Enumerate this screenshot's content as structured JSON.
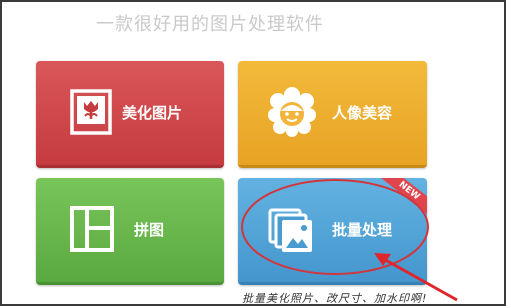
{
  "header": {
    "title": "一款很好用的图片处理软件"
  },
  "tiles": [
    {
      "label": "美化图片",
      "icon": "photo-flower-icon",
      "color": "#d0474b"
    },
    {
      "label": "人像美容",
      "icon": "face-icon",
      "color": "#eeb02f"
    },
    {
      "label": "拼图",
      "icon": "collage-icon",
      "color": "#6ab74d"
    },
    {
      "label": "批量处理",
      "icon": "stacked-photos-icon",
      "color": "#55a5d8",
      "badge": "NEW"
    }
  ],
  "annotation": {
    "handwritten_note": "批量美化照片、改尺寸、加水印啊!"
  }
}
